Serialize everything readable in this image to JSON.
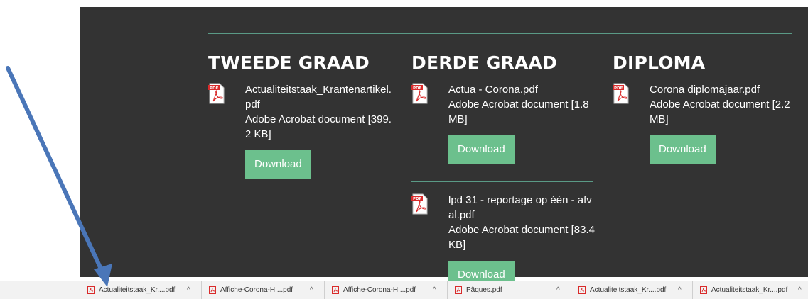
{
  "columns": [
    {
      "heading": "TWEEDE GRAAD",
      "files": [
        {
          "name": "Actualiteitstaak_Krantenartikel.pdf",
          "meta": "Adobe Acrobat document [399.2 KB]",
          "button": "Download"
        }
      ]
    },
    {
      "heading": "DERDE GRAAD",
      "files": [
        {
          "name": "Actua - Corona.pdf",
          "meta": "Adobe Acrobat document [1.8 MB]",
          "button": "Download"
        },
        {
          "name": "lpd 31 - reportage op één - afval.pdf",
          "meta": "Adobe Acrobat document [83.4 KB]",
          "button": "Download"
        }
      ]
    },
    {
      "heading": "DIPLOMA",
      "files": [
        {
          "name": "Corona diplomajaar.pdf",
          "meta": "Adobe Acrobat document [2.2 MB]",
          "button": "Download"
        }
      ]
    }
  ],
  "pdf_icon_label": "PDF",
  "download_bar": [
    {
      "name": "Actualiteitstaak_Kr....pdf",
      "chevron": "^"
    },
    {
      "name": "Affiche-Corona-H....pdf",
      "chevron": "^"
    },
    {
      "name": "Affiche-Corona-H....pdf",
      "chevron": "^"
    },
    {
      "name": "Pâques.pdf",
      "chevron": "^"
    },
    {
      "name": "Actualiteitstaak_Kr....pdf",
      "chevron": "^"
    },
    {
      "name": "Actualiteitstaak_Kr....pdf",
      "chevron": "^"
    }
  ],
  "colors": {
    "panel_bg": "#333333",
    "button": "#6cc08d",
    "divider": "#5a9a86",
    "arrow": "#4a76b8",
    "pdf_red": "#d92b2b"
  }
}
